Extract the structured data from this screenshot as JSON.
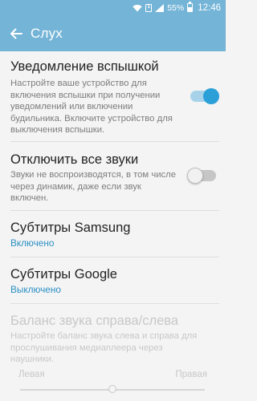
{
  "status_bar": {
    "battery": "55%",
    "time": "12:46",
    "sim_label": "1"
  },
  "app_bar": {
    "title": "Слух"
  },
  "settings": [
    {
      "title": "Уведомление вспышкой",
      "description": "Настройте ваше устройство для включения вспышки при получении уведомлений или включении будильника. Включите устройство для выключения вспышки.",
      "toggle": "on"
    },
    {
      "title": "Отключить все звуки",
      "description": "Звуки не воспроизводятся, в том числе через динамик, даже если звук включен.",
      "toggle": "off"
    },
    {
      "title": "Субтитры Samsung",
      "subtitle": "Включено"
    },
    {
      "title": "Субтитры Google",
      "subtitle": "Выключено"
    },
    {
      "title": "Баланс звука справа/слева",
      "description": "Настройте баланс звука слева и справа для прослушивания медиаплеера через наушники.",
      "left_label": "Левая",
      "right_label": "Правая",
      "balance_position": 0.5,
      "enabled": false
    }
  ],
  "colors": {
    "accent": "#74b4d7",
    "link": "#2a8fc3",
    "toggle_on": "#2a9fd8"
  }
}
